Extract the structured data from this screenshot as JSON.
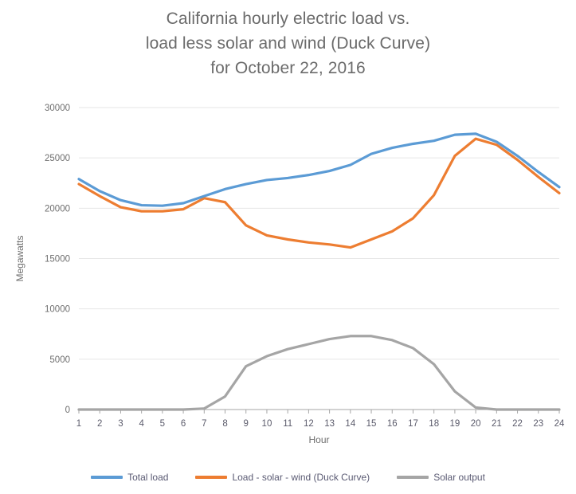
{
  "chart_data": {
    "type": "line",
    "title": "California hourly electric load vs. load less solar and wind (Duck Curve) for October 22, 2016",
    "title_lines": [
      "California hourly electric load vs.",
      "load less solar and wind (Duck Curve)",
      "for October 22, 2016"
    ],
    "xlabel": "Hour",
    "ylabel": "Megawatts",
    "x": [
      1,
      2,
      3,
      4,
      5,
      6,
      7,
      8,
      9,
      10,
      11,
      12,
      13,
      14,
      15,
      16,
      17,
      18,
      19,
      20,
      21,
      22,
      23,
      24
    ],
    "xticklabels": [
      "1",
      "2",
      "3",
      "4",
      "5",
      "6",
      "7",
      "8",
      "9",
      "10",
      "11",
      "12",
      "13",
      "14",
      "15",
      "16",
      "17",
      "18",
      "19",
      "20",
      "21",
      "22",
      "23",
      "24"
    ],
    "yticks": [
      0,
      5000,
      10000,
      15000,
      20000,
      25000,
      30000
    ],
    "yticklabels": [
      "0",
      "5000",
      "10000",
      "15000",
      "20000",
      "25000",
      "30000"
    ],
    "ylim": [
      0,
      30000
    ],
    "xlim": [
      1,
      24
    ],
    "grid": "horizontal",
    "legend_position": "bottom",
    "series": [
      {
        "name": "Total load",
        "color": "#5B9BD5",
        "values": [
          22900,
          21700,
          20800,
          20300,
          20250,
          20500,
          21200,
          21900,
          22400,
          22800,
          23000,
          23300,
          23700,
          24300,
          25400,
          26000,
          26400,
          26700,
          27300,
          27400,
          26600,
          25200,
          23600,
          22100
        ]
      },
      {
        "name": "Load - solar - wind (Duck Curve)",
        "color": "#ED7D31",
        "values": [
          22400,
          21200,
          20100,
          19700,
          19700,
          19900,
          21000,
          20600,
          18300,
          17300,
          16900,
          16600,
          16400,
          16100,
          16900,
          17700,
          19000,
          21300,
          25200,
          26900,
          26300,
          24800,
          23100,
          21500
        ]
      },
      {
        "name": "Solar output",
        "color": "#A5A5A5",
        "values": [
          0,
          0,
          0,
          0,
          0,
          0,
          100,
          1300,
          4300,
          5300,
          6000,
          6500,
          7000,
          7300,
          7300,
          6900,
          6100,
          4500,
          1800,
          200,
          0,
          0,
          0,
          0
        ]
      }
    ]
  },
  "colors": {
    "title": "#6b6b6b",
    "grid": "#e6e6e6",
    "axis": "#a6a6a6",
    "tick_text": "#5a5a6a"
  }
}
